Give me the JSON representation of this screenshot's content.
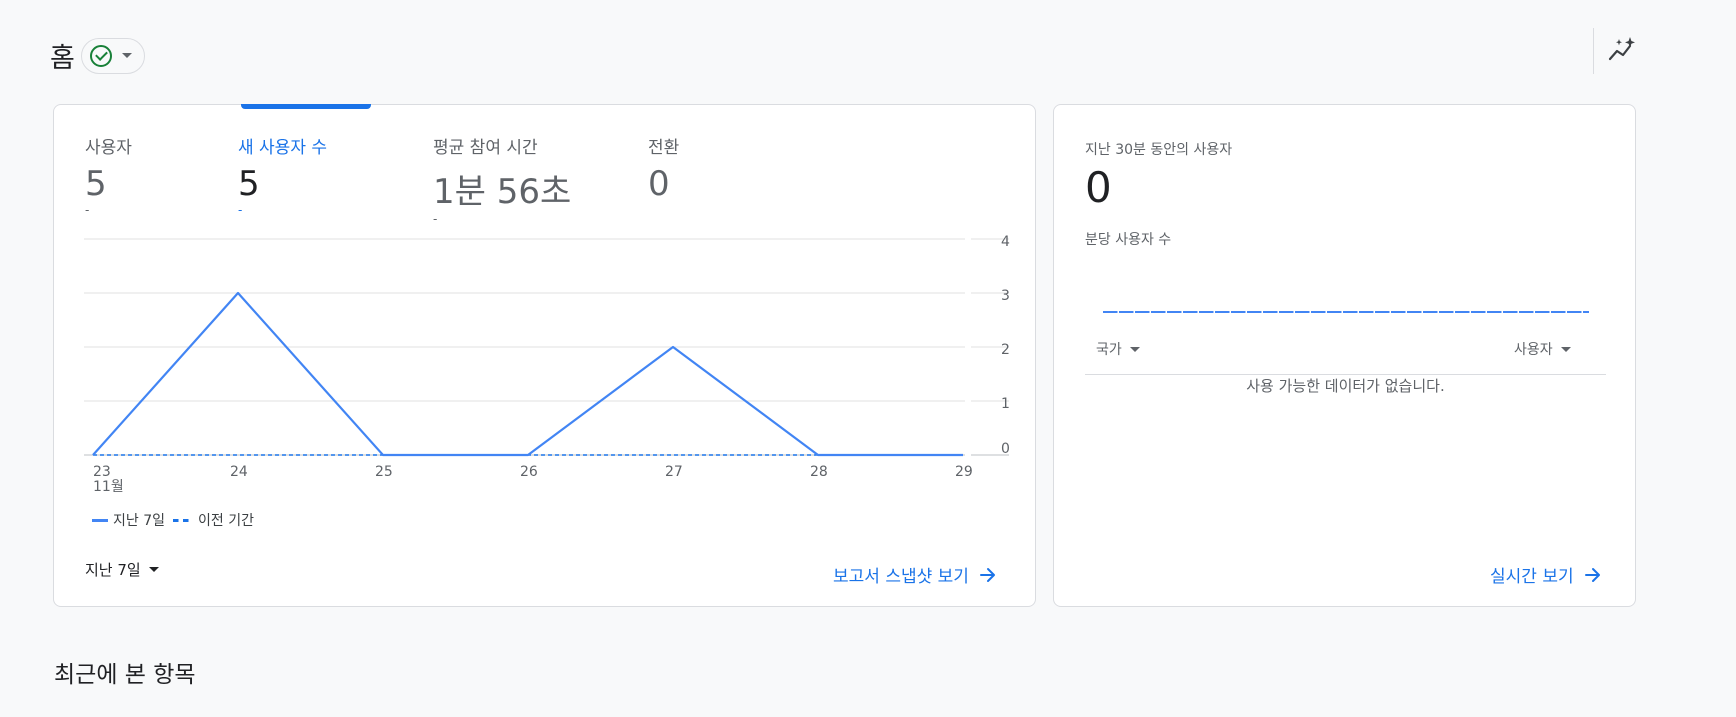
{
  "header": {
    "title": "홈"
  },
  "metrics": [
    {
      "label": "사용자",
      "value": "5",
      "delta": "-",
      "active": false
    },
    {
      "label": "새 사용자 수",
      "value": "5",
      "delta": "-",
      "active": true
    },
    {
      "label": "평균 참여 시간",
      "value": "1분 56초",
      "delta": "-",
      "active": false
    },
    {
      "label": "전환",
      "value": "0",
      "delta": "",
      "active": false
    }
  ],
  "chart_data": {
    "type": "line",
    "categories": [
      "23",
      "24",
      "25",
      "26",
      "27",
      "28",
      "29"
    ],
    "x_sublabel": "11월",
    "yticks": [
      0,
      1,
      2,
      3,
      4
    ],
    "ylim": [
      0,
      4
    ],
    "series": [
      {
        "name": "지난 7일",
        "values": [
          0,
          3,
          0,
          0,
          2,
          0,
          0
        ],
        "style": "solid",
        "color": "#4285f4"
      },
      {
        "name": "이전 기간",
        "values": [
          0,
          0,
          0,
          0,
          0,
          0,
          0
        ],
        "style": "dashed",
        "color": "#1a73e8"
      }
    ]
  },
  "main_card": {
    "date_range": "지난 7일",
    "snapshot_link": "보고서 스냅샷 보기"
  },
  "realtime": {
    "title": "지난 30분 동안의 사용자",
    "value": "0",
    "subtitle": "분당 사용자 수",
    "col_country": "국가",
    "col_users": "사용자",
    "empty_text": "사용 가능한 데이터가 없습니다.",
    "link": "실시간 보기"
  },
  "recent": {
    "title": "최근에 본 항목"
  }
}
